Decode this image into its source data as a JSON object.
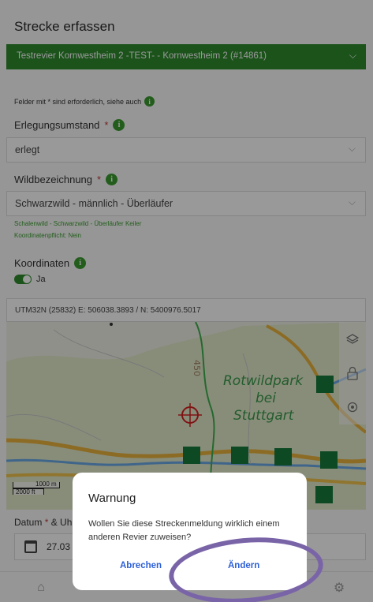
{
  "page": {
    "title": "Strecke erfassen",
    "revier_value": "Testrevier Kornwestheim 2 -TEST- - Kornwestheim 2 (#14861)",
    "hint_text": "Felder mit * sind erforderlich, siehe auch"
  },
  "erlegungsumstand": {
    "label": "Erlegungsumstand",
    "required_mark": "*",
    "value": "erlegt"
  },
  "wildbezeichnung": {
    "label": "Wildbezeichnung",
    "required_mark": "*",
    "value": "Schwarzwild - männlich - Überläufer",
    "subtext": "Schalenwild - Schwarzwild - Überläufer Keiler",
    "koordinatenpflicht": "Koordinatenpflicht: Nein"
  },
  "koordinaten": {
    "label": "Koordinaten",
    "toggle_label": "Ja",
    "toggle_on": true,
    "value": "UTM32N (25832) E: 506038.3893 / N: 5400976.5017"
  },
  "map": {
    "place_label_1": "Rotwildpark",
    "place_label_2": "bei",
    "place_label_3": "Stuttgart",
    "contour_label": "450",
    "scale_m": "1000 m",
    "scale_ft": "2000 ft",
    "controls": [
      "layers-icon",
      "lock-icon",
      "locate-icon"
    ]
  },
  "datum": {
    "label_part1": "Datum",
    "required_mark": "*",
    "label_part2": "& Uh",
    "value": "27.03"
  },
  "dialog": {
    "title": "Warnung",
    "message": "Wollen Sie diese Streckenmeldung wirklich einem anderen Revier zuweisen?",
    "cancel_label": "Abrechen",
    "confirm_label": "Ändern"
  },
  "icons": {
    "info": "i",
    "chevron": "⌵",
    "home": "⌂",
    "settings": "⚙"
  },
  "colors": {
    "brand_green": "#2e8b2e",
    "link_blue": "#2c5fd6",
    "annotation": "#7a64a8"
  }
}
